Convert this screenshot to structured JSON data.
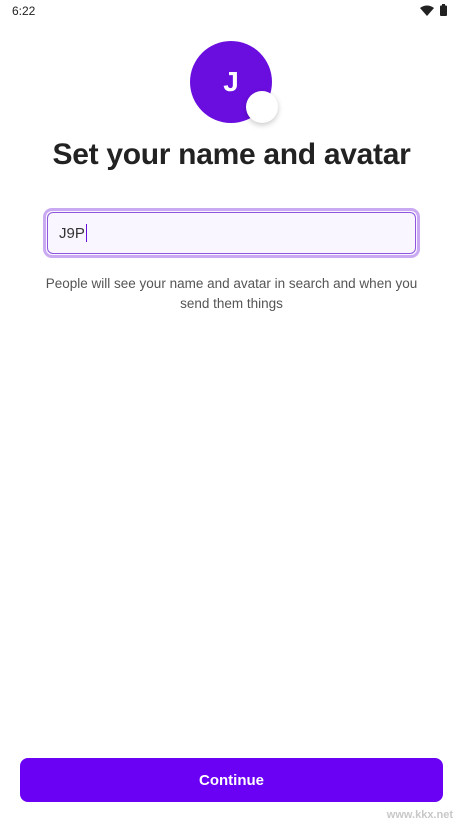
{
  "status_bar": {
    "time": "6:22",
    "icons": [
      "wifi-icon",
      "battery-icon"
    ]
  },
  "avatar": {
    "initial": "J",
    "color": "#6a0ee0"
  },
  "title": "Set your name and avatar",
  "name_input": {
    "value": "J9P"
  },
  "helper_text": "People will see your name and avatar in search and when you send them things",
  "continue_button": {
    "label": "Continue",
    "color": "#6a00f4"
  },
  "watermark": "www.kkx.net"
}
